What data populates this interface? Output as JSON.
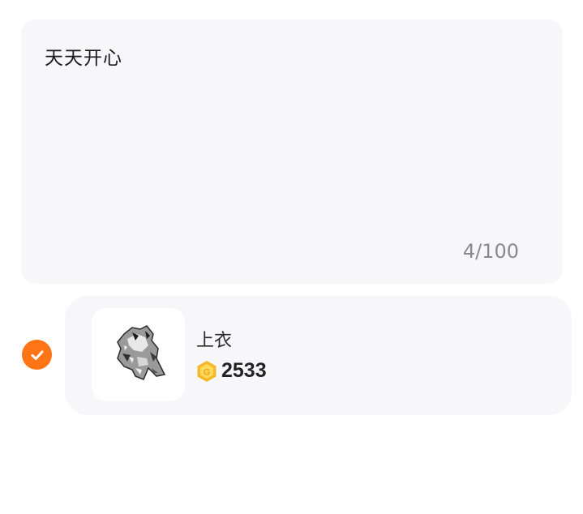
{
  "note_input": {
    "value": "天天开心",
    "counter": "4/100"
  },
  "item": {
    "selected": true,
    "name": "上衣",
    "price": "2533",
    "currency_icon": "coin-icon",
    "image_icon": "clothing-image"
  },
  "colors": {
    "accent": "#ff7414",
    "coin": "#f5b82a",
    "card_bg": "#f7f7f9"
  }
}
